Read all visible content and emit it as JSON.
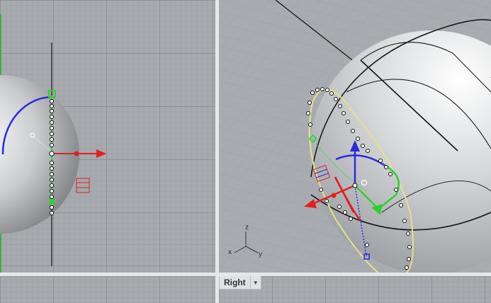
{
  "viewports": {
    "right_tab": {
      "label": "Right",
      "dropdown_icon": "chevron-down-icon"
    },
    "axis_labels": {
      "x": "x",
      "y": "y",
      "z": "z"
    }
  }
}
